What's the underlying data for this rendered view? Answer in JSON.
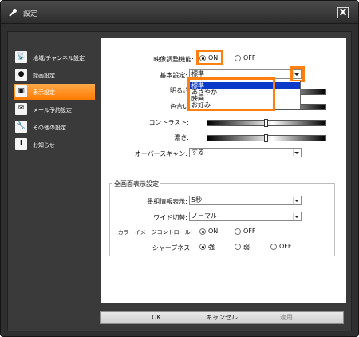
{
  "window": {
    "title": "設定",
    "close_label": "X"
  },
  "sidebar": {
    "items": [
      {
        "label": "地域/チャンネル設定",
        "icon": "antenna-icon",
        "glyph": "📡"
      },
      {
        "label": "録画設定",
        "icon": "record-icon",
        "glyph": "●"
      },
      {
        "label": "表示設定",
        "icon": "display-icon",
        "glyph": "▣"
      },
      {
        "label": "メール予約設定",
        "icon": "mail-icon",
        "glyph": "✉"
      },
      {
        "label": "その他の設定",
        "icon": "wrench-icon",
        "glyph": "🔧"
      },
      {
        "label": "お知らせ",
        "icon": "info-icon",
        "glyph": "i"
      }
    ],
    "active_index": 2
  },
  "display": {
    "video_adjust": {
      "label": "映像調整機能:",
      "on": "ON",
      "off": "OFF",
      "selected": "ON"
    },
    "base_setting": {
      "label": "基本設定:",
      "value": "標準",
      "options": [
        "標準",
        "あざやか",
        "映画",
        "お好み"
      ],
      "selected_index": 0
    },
    "brightness": {
      "label": "明るさ",
      "value_fraction": 0.0
    },
    "color": {
      "label": "色合い",
      "value_fraction": 0.0
    },
    "contrast": {
      "label": "コントラスト:",
      "value_fraction": 0.5
    },
    "depth": {
      "label": "濃さ:",
      "value_fraction": 0.5
    },
    "overscan": {
      "label": "オーバースキャン:",
      "value": "する"
    }
  },
  "fullscreen": {
    "title": "全画面表示設定",
    "program_info": {
      "label": "番組情報表示:",
      "value": "5秒"
    },
    "wide_switch": {
      "label": "ワイド切替:",
      "value": "ノーマル"
    },
    "color_image_control": {
      "label": "カラーイメージコントロール:",
      "on": "ON",
      "off": "OFF",
      "selected": "ON"
    },
    "sharpness": {
      "label": "シャープネス:",
      "options": [
        "強",
        "弱",
        "OFF"
      ],
      "selected": "強"
    }
  },
  "buttons": {
    "ok": "OK",
    "cancel": "キャンセル",
    "apply": "適用"
  },
  "colors": {
    "accent": "#ff7f11",
    "selection": "#0b39c8",
    "window": "#2f2f2f"
  }
}
